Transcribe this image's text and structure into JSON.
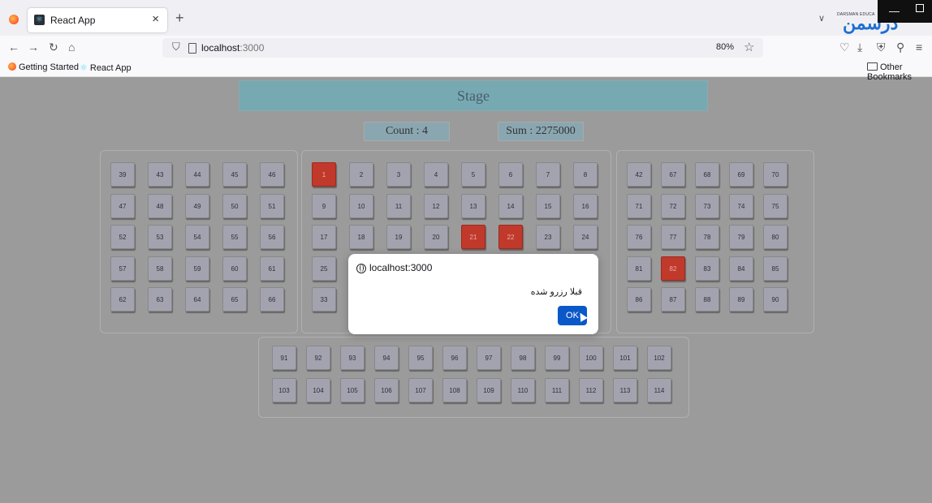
{
  "browser": {
    "tab_title": "React App",
    "tab_close": "×",
    "new_tab": "+",
    "url_host": "localhost",
    "url_port": ":3000",
    "zoom": "80%",
    "bookmarks": [
      "Getting Started",
      "React App"
    ],
    "other_bookmarks": "Other Bookmarks",
    "brand_small_text": "DARSMAN EDUCA",
    "brand_logo": "درسمن"
  },
  "page": {
    "stage_label": "Stage",
    "count_text": "Count : 4",
    "sum_text": "Sum : 2275000",
    "sections": {
      "left": [
        [
          39,
          43,
          44,
          45,
          46
        ],
        [
          47,
          48,
          49,
          50,
          51
        ],
        [
          52,
          53,
          54,
          55,
          56
        ],
        [
          57,
          58,
          59,
          60,
          61
        ],
        [
          62,
          63,
          64,
          65,
          66
        ]
      ],
      "middle": [
        [
          1,
          2,
          3,
          4,
          5,
          6,
          7,
          8
        ],
        [
          9,
          10,
          11,
          12,
          13,
          14,
          15,
          16
        ],
        [
          17,
          18,
          19,
          20,
          21,
          22,
          23,
          24
        ],
        [
          25
        ],
        [
          33
        ]
      ],
      "right": [
        [
          42,
          67,
          68,
          69,
          70
        ],
        [
          71,
          72,
          73,
          74,
          75
        ],
        [
          76,
          77,
          78,
          79,
          80
        ],
        [
          81,
          82,
          83,
          84,
          85
        ],
        [
          86,
          87,
          88,
          89,
          90
        ]
      ],
      "bottom": [
        [
          91,
          92,
          93,
          94,
          95,
          96,
          97,
          98,
          99,
          100,
          101,
          102
        ],
        [
          103,
          104,
          105,
          106,
          107,
          108,
          109,
          110,
          111,
          112,
          113,
          114
        ]
      ]
    },
    "reserved_seats": [
      1,
      21,
      22,
      82
    ]
  },
  "dialog": {
    "title": "localhost:3000",
    "message": "قبلا رزرو شده",
    "ok_label": "OK"
  },
  "colors": {
    "reserved": "#c0392b",
    "seat": "#a3a3b0",
    "stage": "#77a9b3",
    "ok_button": "#0b58c8"
  }
}
